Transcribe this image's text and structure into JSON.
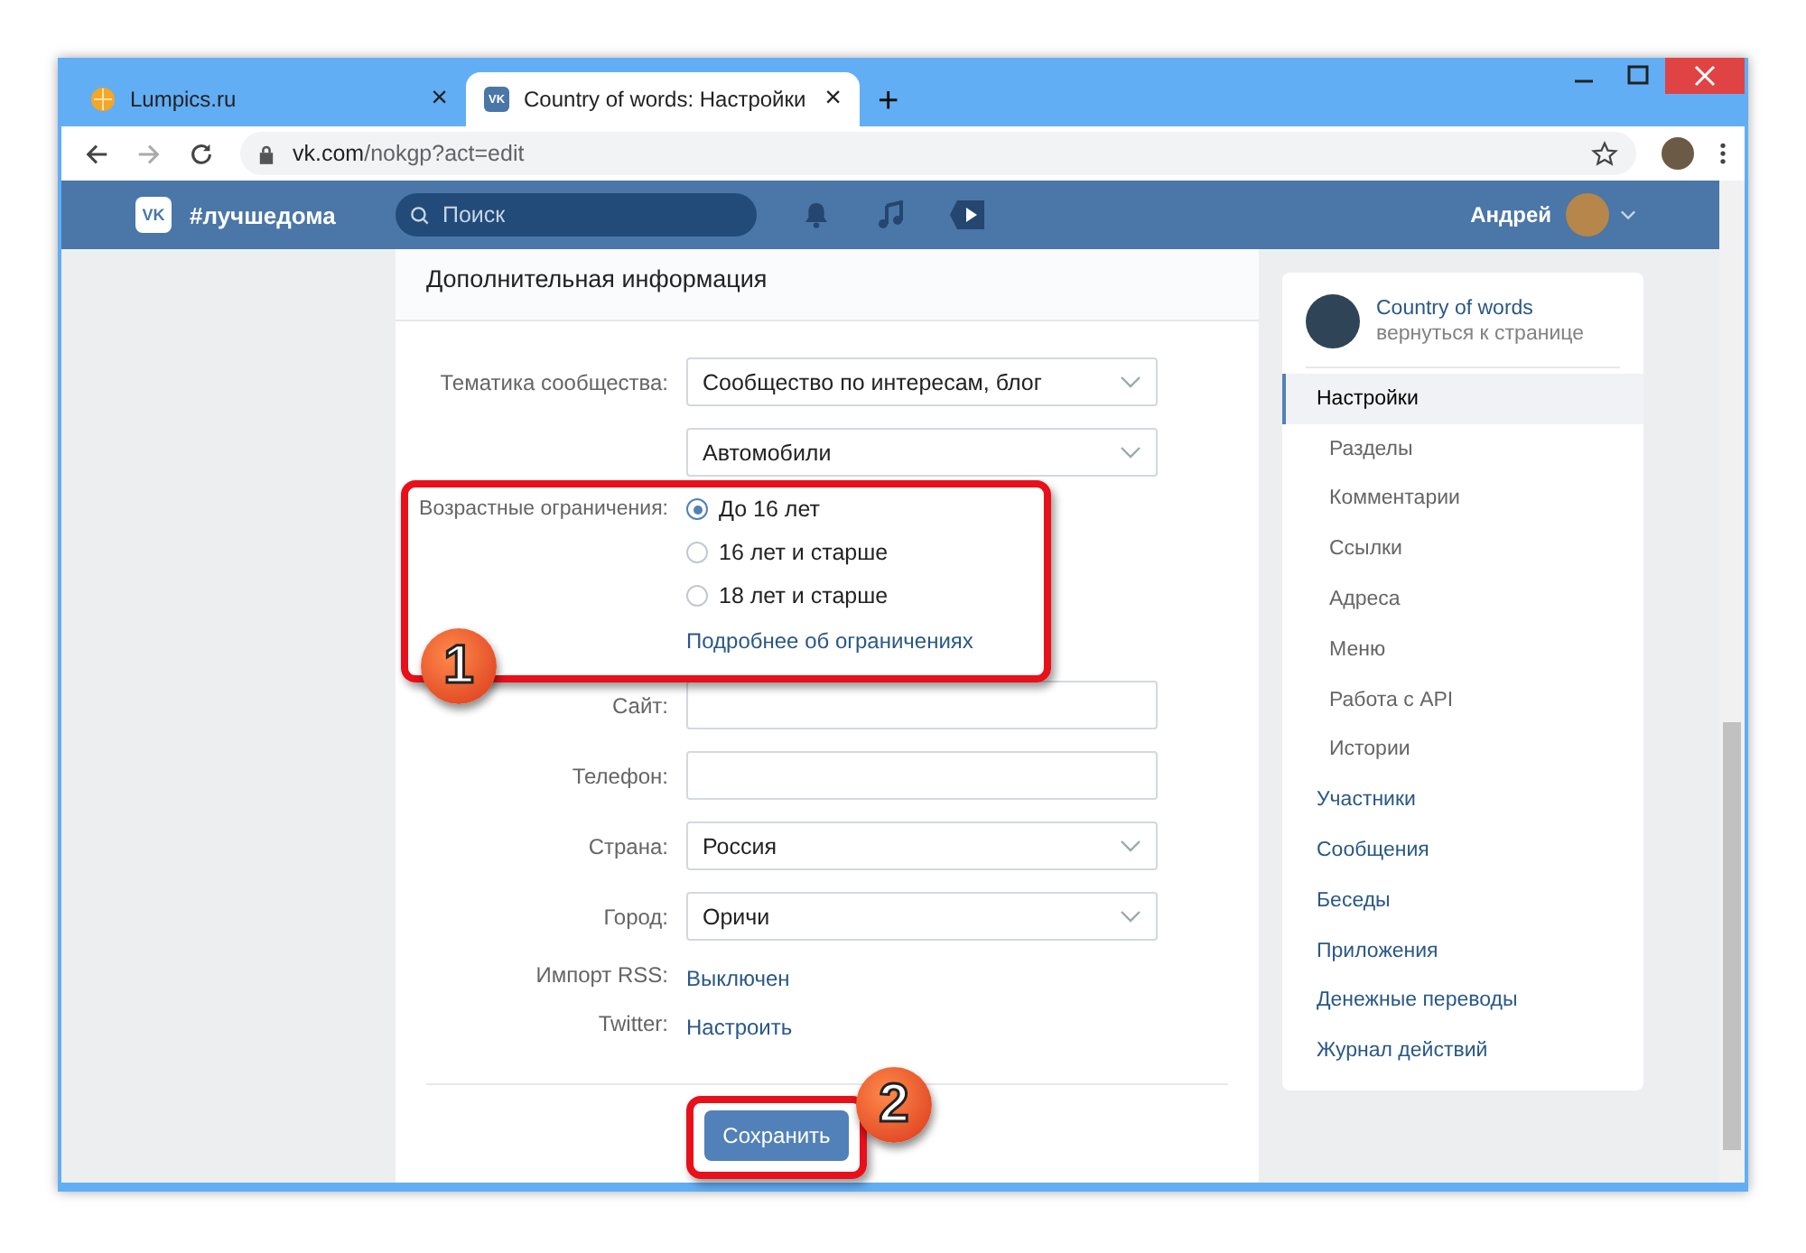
{
  "browser": {
    "tabs": [
      {
        "title": "Lumpics.ru",
        "selected": false,
        "close": "×"
      },
      {
        "title": "Country of words: Настройки",
        "selected": true,
        "favicon_text": "VK",
        "close": "×"
      }
    ],
    "new_tab": "+",
    "url_host": "vk.com",
    "url_path": "/nokgp?act=edit"
  },
  "vk_header": {
    "logo": "VK",
    "brand": "#лучшедома",
    "search_placeholder": "Поиск",
    "user": "Андрей"
  },
  "form": {
    "title": "Дополнительная информация",
    "rows": [
      {
        "kind": "select",
        "label": "Тематика сообщества:",
        "value": "Сообщество по интересам, блог"
      },
      {
        "kind": "select",
        "value": "Автомобили"
      },
      {
        "kind": "radios",
        "label": "Возрастные ограничения:",
        "options": [
          {
            "label": "До 16 лет",
            "selected": true
          },
          {
            "label": "16 лет и старше",
            "selected": false
          },
          {
            "label": "18 лет и старше",
            "selected": false
          }
        ],
        "link": "Подробнее об ограничениях"
      },
      {
        "kind": "input",
        "label": "Сайт:"
      },
      {
        "kind": "input",
        "label": "Телефон:"
      },
      {
        "kind": "select",
        "label": "Страна:",
        "value": "Россия"
      },
      {
        "kind": "select",
        "label": "Город:",
        "value": "Оричи"
      },
      {
        "kind": "link",
        "label": "Импорт RSS:",
        "value": "Выключен"
      },
      {
        "kind": "link",
        "label": "Twitter:",
        "value": "Настроить"
      }
    ],
    "save_button": "Сохранить"
  },
  "sidebar": {
    "community": "Country of words",
    "back_link": "вернуться к странице",
    "items": [
      {
        "label": "Настройки",
        "selected": true,
        "children": [
          {
            "label": "Разделы",
            "selected": false
          },
          {
            "label": "Комментарии",
            "selected": false
          },
          {
            "label": "Ссылки",
            "selected": false
          },
          {
            "label": "Адреса",
            "selected": false
          },
          {
            "label": "Меню",
            "selected": false
          },
          {
            "label": "Работа с API",
            "selected": false
          },
          {
            "label": "Истории",
            "selected": false
          }
        ]
      },
      {
        "label": "Участники",
        "selected": false
      },
      {
        "label": "Сообщения",
        "selected": false
      },
      {
        "label": "Беседы",
        "selected": false
      },
      {
        "label": "Приложения",
        "selected": false
      },
      {
        "label": "Денежные переводы",
        "selected": false
      },
      {
        "label": "Журнал действий",
        "selected": false
      }
    ]
  },
  "callouts": [
    {
      "number": "1"
    },
    {
      "number": "2"
    }
  ]
}
